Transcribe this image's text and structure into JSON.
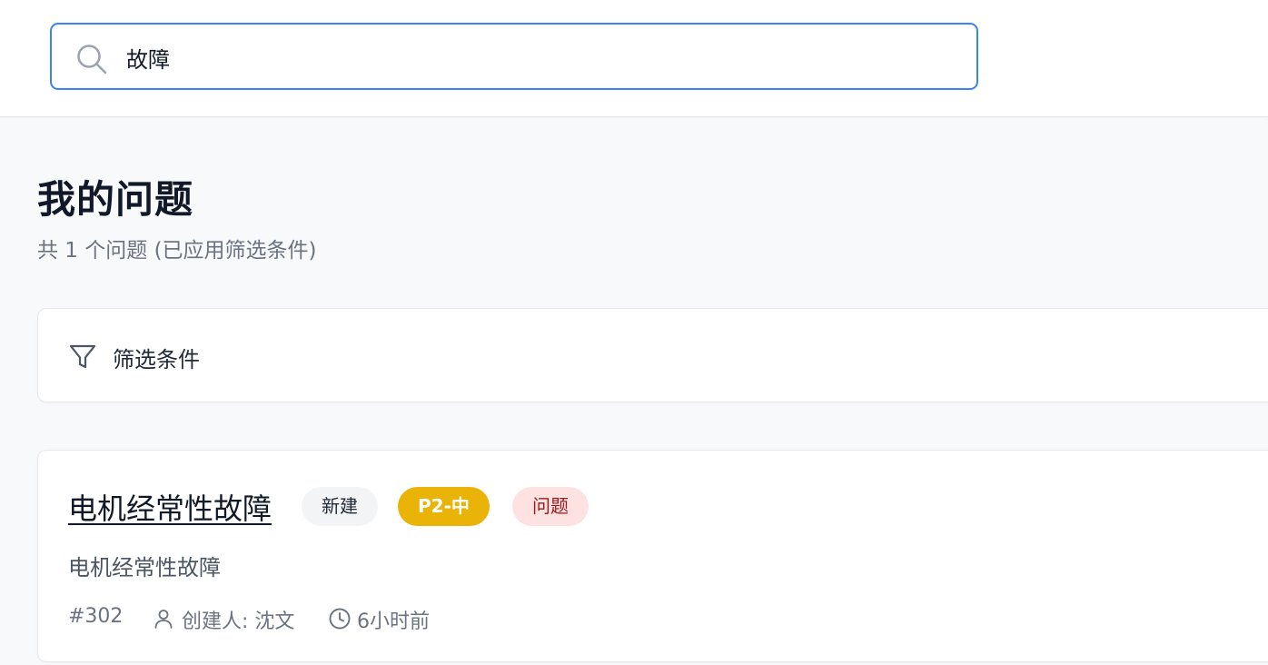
{
  "search": {
    "value": "故障",
    "icon": "search-icon"
  },
  "page": {
    "title": "我的问题",
    "subtitle": "共 1 个问题 (已应用筛选条件)"
  },
  "filter": {
    "label": "筛选条件",
    "icon": "filter-icon"
  },
  "issues": [
    {
      "title": "电机经常性故障",
      "status": "新建",
      "priority": "P2-中",
      "type": "问题",
      "description": "电机经常性故障",
      "id": "#302",
      "creator": "创建人: 沈文",
      "time": "6小时前"
    }
  ],
  "colors": {
    "accent": "#3b82f6",
    "priority_badge": "#eab308",
    "type_badge_bg": "#fee2e2",
    "type_badge_text": "#991b1b",
    "status_badge_bg": "#f3f4f6"
  }
}
